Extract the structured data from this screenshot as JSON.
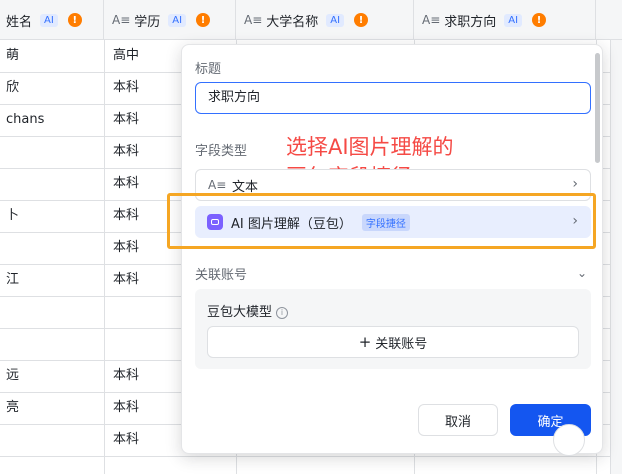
{
  "table": {
    "columns": [
      {
        "type_icon": "",
        "name": "姓名",
        "ai": "AI",
        "warn": "!"
      },
      {
        "type_icon": "A≡",
        "name": "学历",
        "ai": "AI",
        "warn": "!"
      },
      {
        "type_icon": "A≡",
        "name": "大学名称",
        "ai": "AI",
        "warn": "!"
      },
      {
        "type_icon": "A≡",
        "name": "求职方向",
        "ai": "AI",
        "warn": "!"
      }
    ],
    "rows": [
      {
        "name": "萌",
        "edu": "高中"
      },
      {
        "name": "欣",
        "edu": "本科"
      },
      {
        "name": " chans",
        "edu": "本科"
      },
      {
        "name": "",
        "edu": "本科"
      },
      {
        "name": "",
        "edu": "本科"
      },
      {
        "name": "卜",
        "edu": "本科"
      },
      {
        "name": "",
        "edu": "本科"
      },
      {
        "name": "江",
        "edu": "本科"
      },
      {
        "name": "",
        "edu": ""
      },
      {
        "name": "",
        "edu": ""
      },
      {
        "name": "远",
        "edu": "本科"
      },
      {
        "name": "亮",
        "edu": "本科"
      },
      {
        "name": "",
        "edu": "本科"
      }
    ]
  },
  "panel": {
    "title_label": "标题",
    "title_value": "求职方向",
    "field_type_label": "字段类型",
    "annotation_line1": "选择AI图片理解的",
    "annotation_line2": "豆包字段捷径",
    "option_text": {
      "icon": "A≡",
      "label": "文本",
      "chevron": "›"
    },
    "option_ai": {
      "label": "AI 图片理解（豆包）",
      "tag": "字段捷径",
      "chevron": "›"
    },
    "linked_account_label": "关联账号",
    "linked_chevron": "⌄",
    "model_label": "豆包大模型",
    "info_icon": "i",
    "link_button": {
      "plus": "+",
      "label": "关联账号"
    },
    "cancel_label": "取消",
    "ok_label": "确定"
  },
  "colors": {
    "accent": "#1456f0",
    "annotation": "#f54a45",
    "highlight_box": "#f5a623",
    "warn": "#ff7d00"
  }
}
